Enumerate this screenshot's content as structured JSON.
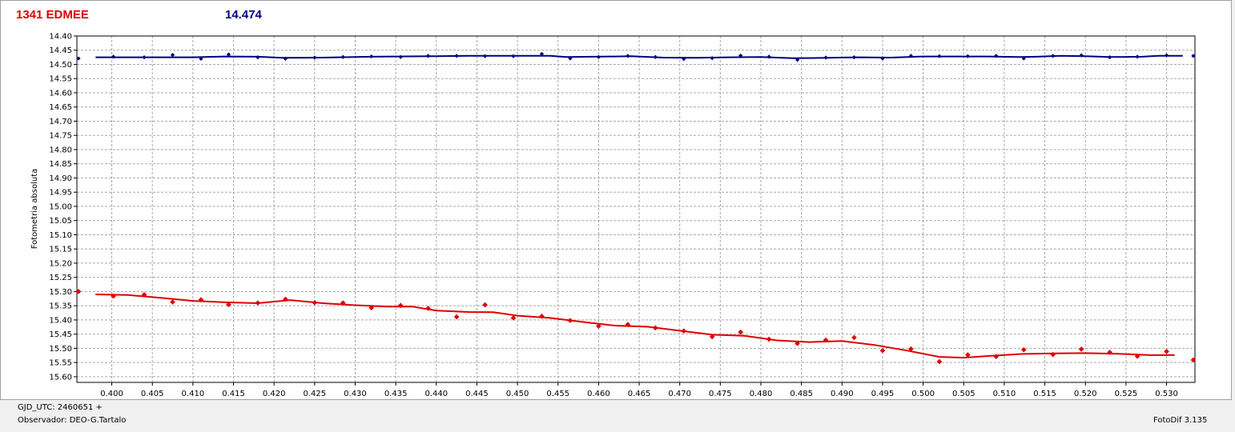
{
  "header": {
    "object_name": "1341 EDMEE",
    "comparison_mag": "14.474",
    "object_color": "#e00000",
    "comparison_color": "#000080"
  },
  "footer": {
    "gjd_label": "GJD_UTC: 2460651 +",
    "observer_label": "Observador: DEO-G.Tartalo",
    "software_label": "FotoDif 3.135"
  },
  "chart_data": {
    "type": "scatter",
    "ylabel": "Fotometria absoluta",
    "xlabel": "",
    "xlim": [
      0.3957,
      0.5335
    ],
    "ylim": [
      15.62,
      14.4
    ],
    "y_inverted": true,
    "grid": true,
    "x_ticks": [
      "0.400",
      "0.405",
      "0.410",
      "0.415",
      "0.420",
      "0.425",
      "0.430",
      "0.435",
      "0.440",
      "0.445",
      "0.450",
      "0.455",
      "0.460",
      "0.465",
      "0.470",
      "0.475",
      "0.480",
      "0.485",
      "0.490",
      "0.495",
      "0.500",
      "0.505",
      "0.510",
      "0.515",
      "0.520",
      "0.525",
      "0.530"
    ],
    "y_ticks": [
      "14.40",
      "14.45",
      "14.50",
      "14.55",
      "14.60",
      "14.65",
      "14.70",
      "14.75",
      "14.80",
      "14.85",
      "14.90",
      "14.95",
      "15.00",
      "15.05",
      "15.10",
      "15.15",
      "15.20",
      "15.25",
      "15.30",
      "15.35",
      "15.40",
      "15.45",
      "15.50",
      "15.55",
      "15.60"
    ],
    "series": [
      {
        "color": "#e00000",
        "points": [
          [
            0.3959,
            15.3
          ],
          [
            0.4002,
            15.316
          ],
          [
            0.404,
            15.311
          ],
          [
            0.4075,
            15.337
          ],
          [
            0.411,
            15.329
          ],
          [
            0.4144,
            15.346
          ],
          [
            0.418,
            15.34
          ],
          [
            0.4214,
            15.327
          ],
          [
            0.425,
            15.339
          ],
          [
            0.4285,
            15.34
          ],
          [
            0.432,
            15.357
          ],
          [
            0.4356,
            15.349
          ],
          [
            0.439,
            15.359
          ],
          [
            0.4425,
            15.389
          ],
          [
            0.446,
            15.347
          ],
          [
            0.4495,
            15.393
          ],
          [
            0.453,
            15.387
          ],
          [
            0.4565,
            15.402
          ],
          [
            0.46,
            15.422
          ],
          [
            0.4636,
            15.416
          ],
          [
            0.467,
            15.428
          ],
          [
            0.4705,
            15.439
          ],
          [
            0.474,
            15.459
          ],
          [
            0.4775,
            15.443
          ],
          [
            0.481,
            15.468
          ],
          [
            0.4845,
            15.483
          ],
          [
            0.488,
            15.471
          ],
          [
            0.4915,
            15.462
          ],
          [
            0.495,
            15.508
          ],
          [
            0.4985,
            15.502
          ],
          [
            0.502,
            15.547
          ],
          [
            0.5055,
            15.523
          ],
          [
            0.509,
            15.529
          ],
          [
            0.5124,
            15.505
          ],
          [
            0.516,
            15.522
          ],
          [
            0.5195,
            15.503
          ],
          [
            0.523,
            15.514
          ],
          [
            0.5264,
            15.528
          ],
          [
            0.53,
            15.511
          ],
          [
            0.5333,
            15.541
          ]
        ],
        "trend": [
          [
            0.398,
            15.31
          ],
          [
            0.402,
            15.312
          ],
          [
            0.406,
            15.322
          ],
          [
            0.41,
            15.333
          ],
          [
            0.414,
            15.338
          ],
          [
            0.418,
            15.341
          ],
          [
            0.422,
            15.33
          ],
          [
            0.426,
            15.341
          ],
          [
            0.43,
            15.348
          ],
          [
            0.434,
            15.353
          ],
          [
            0.437,
            15.353
          ],
          [
            0.44,
            15.367
          ],
          [
            0.444,
            15.372
          ],
          [
            0.447,
            15.373
          ],
          [
            0.45,
            15.385
          ],
          [
            0.454,
            15.393
          ],
          [
            0.458,
            15.407
          ],
          [
            0.462,
            15.42
          ],
          [
            0.466,
            15.424
          ],
          [
            0.47,
            15.438
          ],
          [
            0.474,
            15.452
          ],
          [
            0.478,
            15.456
          ],
          [
            0.482,
            15.472
          ],
          [
            0.486,
            15.478
          ],
          [
            0.49,
            15.474
          ],
          [
            0.494,
            15.488
          ],
          [
            0.498,
            15.508
          ],
          [
            0.502,
            15.53
          ],
          [
            0.505,
            15.533
          ],
          [
            0.508,
            15.527
          ],
          [
            0.512,
            15.52
          ],
          [
            0.516,
            15.518
          ],
          [
            0.52,
            15.517
          ],
          [
            0.524,
            15.519
          ],
          [
            0.528,
            15.524
          ],
          [
            0.531,
            15.524
          ]
        ]
      },
      {
        "color": "#000080",
        "points": [
          [
            0.3959,
            14.479
          ],
          [
            0.4002,
            14.473
          ],
          [
            0.404,
            14.475
          ],
          [
            0.4075,
            14.467
          ],
          [
            0.411,
            14.48
          ],
          [
            0.4144,
            14.465
          ],
          [
            0.418,
            14.475
          ],
          [
            0.4214,
            14.48
          ],
          [
            0.425,
            14.476
          ],
          [
            0.4285,
            14.474
          ],
          [
            0.432,
            14.472
          ],
          [
            0.4356,
            14.474
          ],
          [
            0.439,
            14.47
          ],
          [
            0.4425,
            14.47
          ],
          [
            0.446,
            14.471
          ],
          [
            0.4495,
            14.471
          ],
          [
            0.453,
            14.463
          ],
          [
            0.4565,
            14.479
          ],
          [
            0.46,
            14.474
          ],
          [
            0.4636,
            14.47
          ],
          [
            0.467,
            14.474
          ],
          [
            0.4705,
            14.481
          ],
          [
            0.474,
            14.478
          ],
          [
            0.4775,
            14.469
          ],
          [
            0.481,
            14.473
          ],
          [
            0.4845,
            14.484
          ],
          [
            0.488,
            14.476
          ],
          [
            0.4915,
            14.475
          ],
          [
            0.495,
            14.479
          ],
          [
            0.4985,
            14.47
          ],
          [
            0.502,
            14.471
          ],
          [
            0.5055,
            14.471
          ],
          [
            0.509,
            14.47
          ],
          [
            0.5124,
            14.479
          ],
          [
            0.516,
            14.47
          ],
          [
            0.5195,
            14.468
          ],
          [
            0.523,
            14.475
          ],
          [
            0.5264,
            14.473
          ],
          [
            0.53,
            14.468
          ],
          [
            0.5333,
            14.47
          ]
        ],
        "trend": [
          [
            0.398,
            14.475
          ],
          [
            0.41,
            14.475
          ],
          [
            0.414,
            14.472
          ],
          [
            0.418,
            14.473
          ],
          [
            0.421,
            14.477
          ],
          [
            0.426,
            14.476
          ],
          [
            0.432,
            14.473
          ],
          [
            0.44,
            14.471
          ],
          [
            0.444,
            14.47
          ],
          [
            0.454,
            14.47
          ],
          [
            0.456,
            14.474
          ],
          [
            0.462,
            14.472
          ],
          [
            0.464,
            14.471
          ],
          [
            0.468,
            14.476
          ],
          [
            0.472,
            14.477
          ],
          [
            0.476,
            14.475
          ],
          [
            0.48,
            14.474
          ],
          [
            0.484,
            14.478
          ],
          [
            0.488,
            14.477
          ],
          [
            0.492,
            14.475
          ],
          [
            0.496,
            14.476
          ],
          [
            0.5,
            14.472
          ],
          [
            0.508,
            14.472
          ],
          [
            0.512,
            14.474
          ],
          [
            0.514,
            14.473
          ],
          [
            0.517,
            14.47
          ],
          [
            0.52,
            14.471
          ],
          [
            0.523,
            14.474
          ],
          [
            0.527,
            14.473
          ],
          [
            0.529,
            14.47
          ],
          [
            0.532,
            14.47
          ]
        ]
      }
    ]
  }
}
